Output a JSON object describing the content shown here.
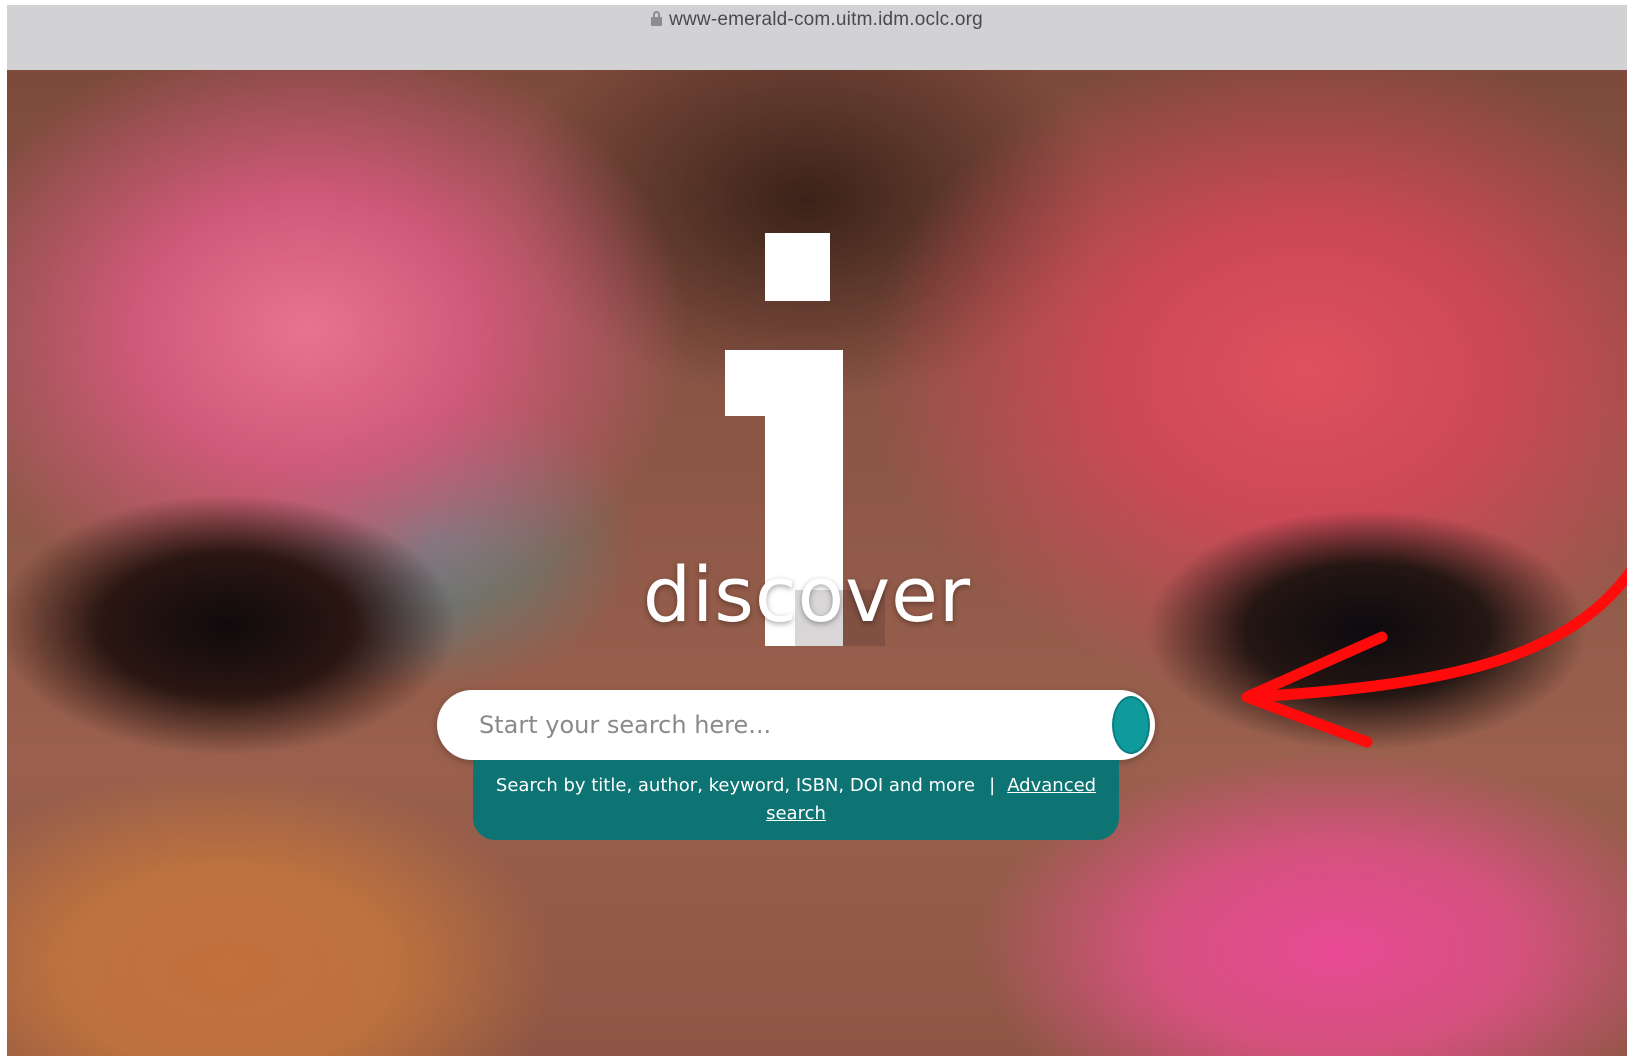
{
  "browser": {
    "url": "www-emerald-com.uitm.idm.oclc.org",
    "lock_icon": "lock-icon"
  },
  "hero": {
    "logo_letter": "i",
    "logo_word": "discover"
  },
  "search": {
    "placeholder": "Start your search here...",
    "value": "",
    "button_icon": "search-button"
  },
  "helper": {
    "text": "Search by title, author, keyword, ISBN, DOI and more",
    "separator": "|",
    "advanced_link": "Advanced search"
  },
  "annotation": {
    "arrow_color": "#ff0b0b"
  },
  "colors": {
    "accent": "#0f9a9c",
    "panel": "#0d7373"
  }
}
